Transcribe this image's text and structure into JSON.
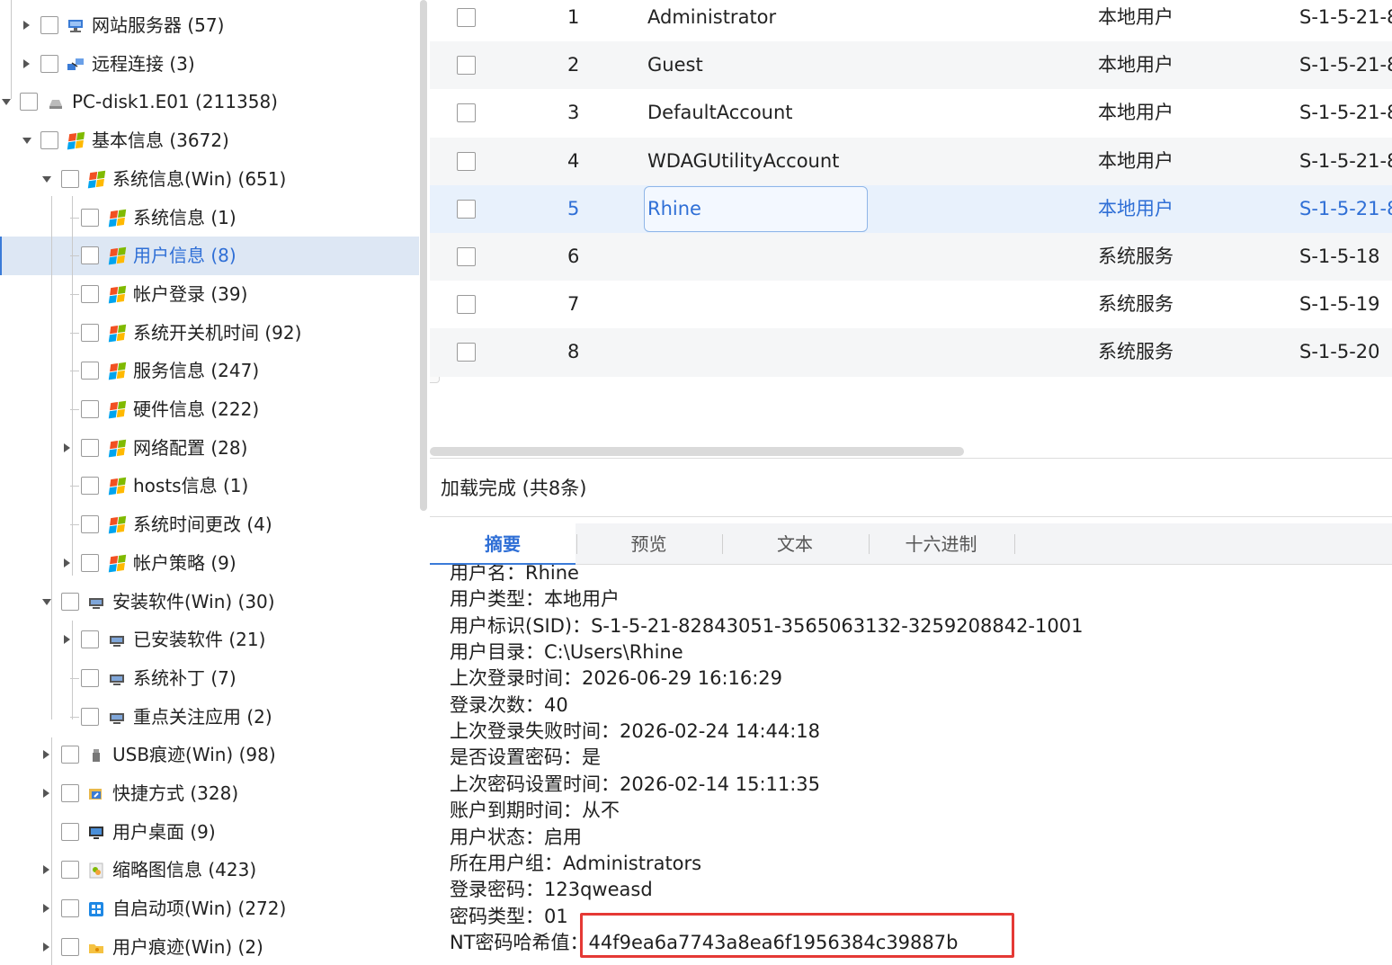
{
  "tree": {
    "items": [
      {
        "label": "网站服务器 (57)",
        "icon": "server-icon",
        "expand": "collapsed"
      },
      {
        "label": "远程连接 (3)",
        "icon": "remote-connection-icon",
        "expand": "collapsed"
      },
      {
        "label": "PC-disk1.E01 (211358)",
        "icon": "disk-image-icon",
        "expand": "expanded"
      },
      {
        "label": "基本信息 (3672)",
        "icon": "windows-flag-icon",
        "expand": "expanded"
      },
      {
        "label": "系统信息(Win) (651)",
        "icon": "windows-flag-icon",
        "expand": "expanded"
      },
      {
        "label": "系统信息 (1)",
        "icon": "windows-flag-icon",
        "expand": "none"
      },
      {
        "label": "用户信息 (8)",
        "icon": "windows-flag-icon",
        "expand": "none",
        "selected": true
      },
      {
        "label": "帐户登录 (39)",
        "icon": "windows-flag-icon",
        "expand": "none"
      },
      {
        "label": "系统开关机时间 (92)",
        "icon": "windows-flag-icon",
        "expand": "none"
      },
      {
        "label": "服务信息 (247)",
        "icon": "windows-flag-icon",
        "expand": "none"
      },
      {
        "label": "硬件信息 (222)",
        "icon": "windows-flag-icon",
        "expand": "none"
      },
      {
        "label": "网络配置 (28)",
        "icon": "windows-flag-icon",
        "expand": "collapsed"
      },
      {
        "label": "hosts信息 (1)",
        "icon": "windows-flag-icon",
        "expand": "none"
      },
      {
        "label": "系统时间更改 (4)",
        "icon": "windows-flag-icon",
        "expand": "none"
      },
      {
        "label": "帐户策略 (9)",
        "icon": "windows-flag-icon",
        "expand": "collapsed"
      },
      {
        "label": "安装软件(Win) (30)",
        "icon": "monitor-icon",
        "expand": "expanded"
      },
      {
        "label": "已安装软件 (21)",
        "icon": "monitor-icon",
        "expand": "collapsed"
      },
      {
        "label": "系统补丁 (7)",
        "icon": "monitor-icon",
        "expand": "none"
      },
      {
        "label": "重点关注应用 (2)",
        "icon": "monitor-icon",
        "expand": "none"
      },
      {
        "label": "USB痕迹(Win) (98)",
        "icon": "usb-icon",
        "expand": "collapsed"
      },
      {
        "label": "快捷方式 (328)",
        "icon": "shortcut-icon",
        "expand": "collapsed"
      },
      {
        "label": "用户桌面 (9)",
        "icon": "desktop-icon",
        "expand": "none"
      },
      {
        "label": "缩略图信息 (423)",
        "icon": "thumbnail-icon",
        "expand": "collapsed"
      },
      {
        "label": "自启动项(Win) (272)",
        "icon": "startup-icon",
        "expand": "collapsed"
      },
      {
        "label": "用户痕迹(Win) (2)",
        "icon": "folder-icon",
        "expand": "collapsed"
      }
    ]
  },
  "grid": {
    "rows": [
      {
        "index": "1",
        "name": "Administrator",
        "type": "本地用户",
        "sid": "S-1-5-21-8"
      },
      {
        "index": "2",
        "name": "Guest",
        "type": "本地用户",
        "sid": "S-1-5-21-8"
      },
      {
        "index": "3",
        "name": "DefaultAccount",
        "type": "本地用户",
        "sid": "S-1-5-21-8"
      },
      {
        "index": "4",
        "name": "WDAGUtilityAccount",
        "type": "本地用户",
        "sid": "S-1-5-21-8"
      },
      {
        "index": "5",
        "name": "Rhine",
        "type": "本地用户",
        "sid": "S-1-5-21-8",
        "selected": true
      },
      {
        "index": "6",
        "name": "",
        "type": "系统服务",
        "sid": "S-1-5-18"
      },
      {
        "index": "7",
        "name": "",
        "type": "系统服务",
        "sid": "S-1-5-19"
      },
      {
        "index": "8",
        "name": "",
        "type": "系统服务",
        "sid": "S-1-5-20"
      }
    ]
  },
  "status": {
    "text": "加载完成 (共8条)"
  },
  "tabs": [
    {
      "label": "摘要",
      "active": true
    },
    {
      "label": "预览"
    },
    {
      "label": "文本"
    },
    {
      "label": "十六进制"
    }
  ],
  "detail": {
    "lines": [
      "用户名：Rhine",
      "用户类型：本地用户",
      "用户标识(SID)：S-1-5-21-82843051-3565063132-3259208842-1001",
      "用户目录：C:\\Users\\Rhine",
      "上次登录时间：2026-06-29 16:16:29",
      "登录次数：40",
      "上次登录失败时间：2026-02-24 14:44:18",
      "是否设置密码：是",
      "上次密码设置时间：2026-02-14 15:11:35",
      "账户到期时间：从不",
      "用户状态：启用",
      "所在用户组：Administrators",
      "登录密码：123qweasd",
      "密码类型：01",
      "NT密码哈希值：44f9ea6a7743a8ea6f1956384c39887b"
    ]
  },
  "colors": {
    "accent": "#2f6fd6",
    "selection": "#dde7f4",
    "highlight_box": "#e53935"
  }
}
